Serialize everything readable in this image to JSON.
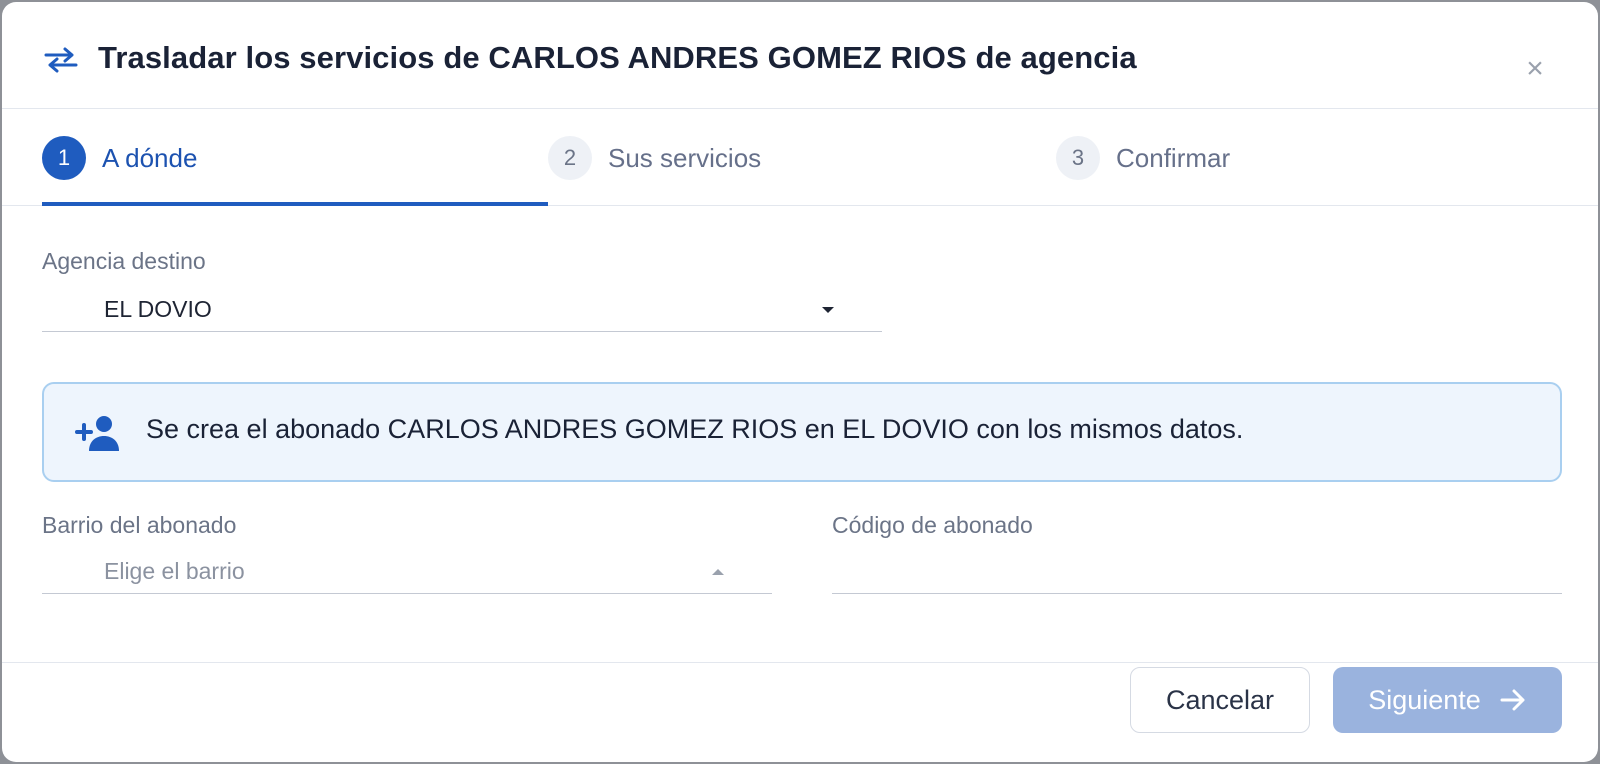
{
  "dialog": {
    "title": "Trasladar los servicios de CARLOS ANDRES GOMEZ RIOS de agencia",
    "close_label": "×"
  },
  "steps": [
    {
      "number": "1",
      "label": "A dónde",
      "active": true
    },
    {
      "number": "2",
      "label": "Sus servicios",
      "active": false
    },
    {
      "number": "3",
      "label": "Confirmar",
      "active": false
    }
  ],
  "form": {
    "agency": {
      "label": "Agencia destino",
      "value": "EL DOVIO"
    },
    "info_message": "Se crea el abonado CARLOS ANDRES GOMEZ RIOS en EL DOVIO con los mismos datos.",
    "neighborhood": {
      "label": "Barrio del abonado",
      "placeholder": "Elige el barrio"
    },
    "subscriber_code": {
      "label": "Código de abonado",
      "value": ""
    }
  },
  "footer": {
    "cancel_label": "Cancelar",
    "next_label": "Siguiente"
  },
  "colors": {
    "accent": "#1f5cbf",
    "next_disabled": "#9ab3de",
    "info_bg": "#eef5fd",
    "info_border": "#a9cff0"
  }
}
